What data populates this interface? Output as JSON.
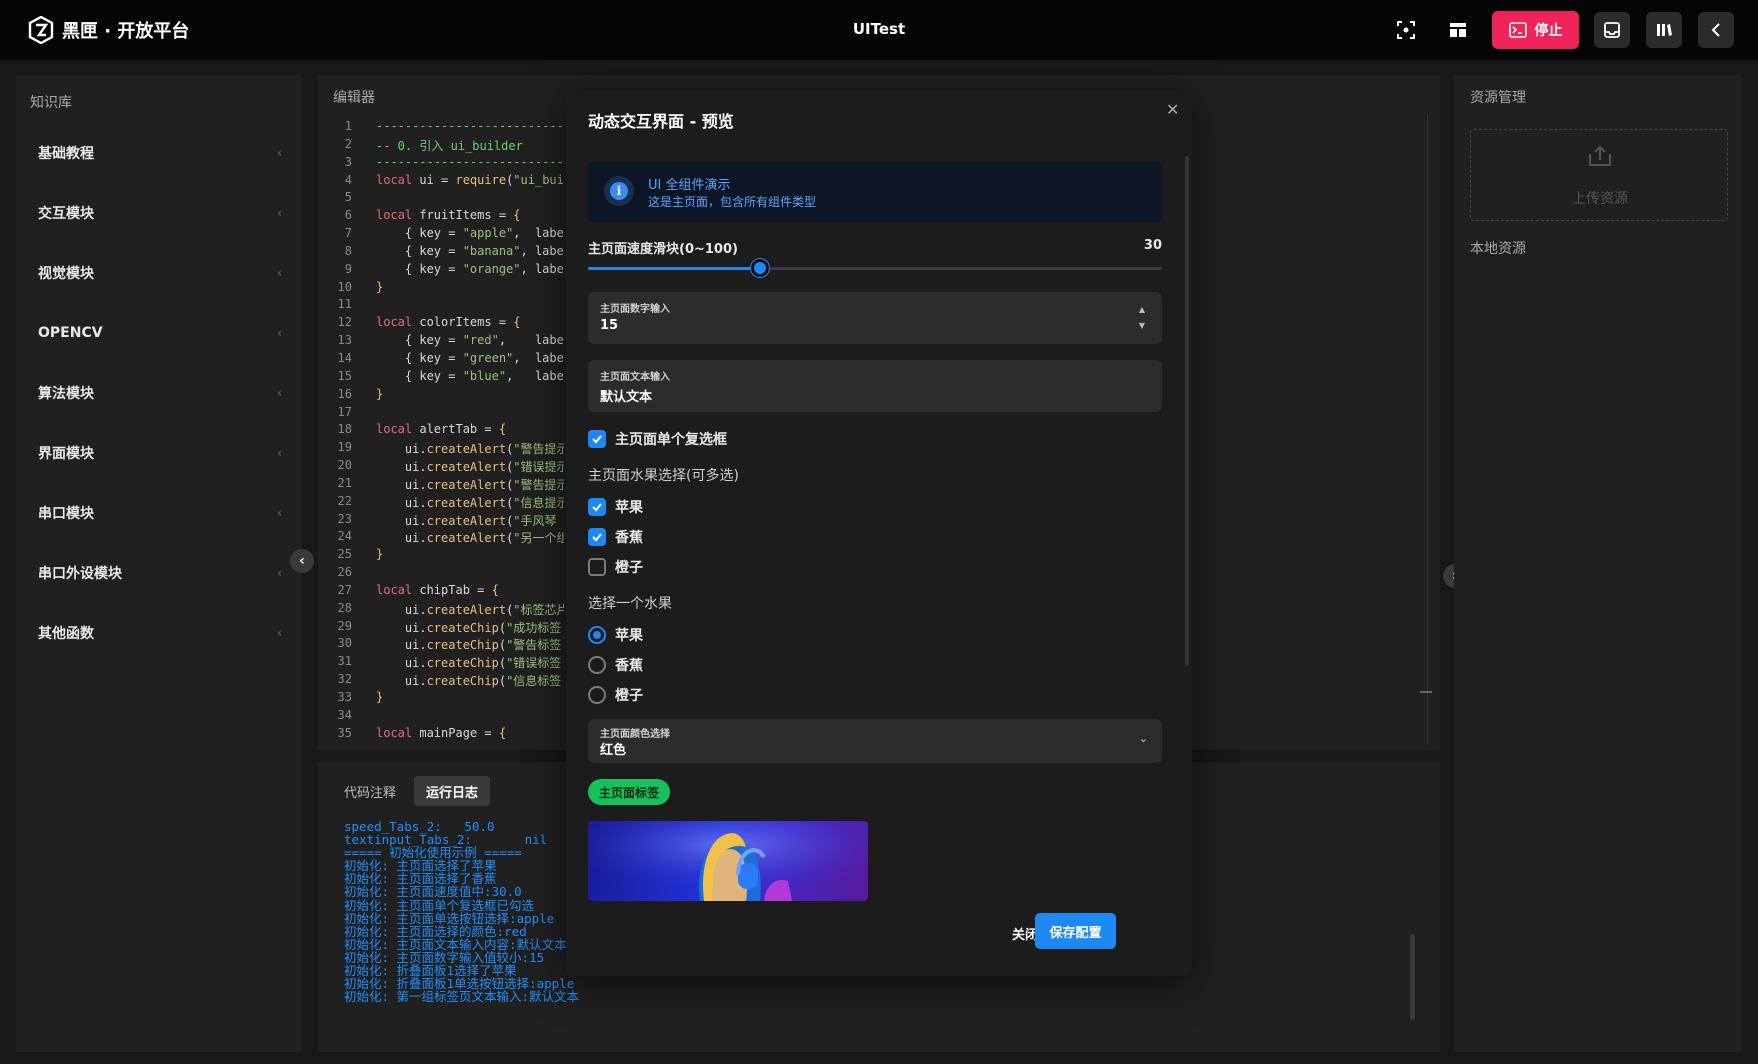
{
  "topbar": {
    "brand": "黑匣 · 开放平台",
    "title": "UITest",
    "stop_label": "停止"
  },
  "knowledge": {
    "title": "知识库",
    "items": [
      {
        "label": "基础教程"
      },
      {
        "label": "交互模块"
      },
      {
        "label": "视觉模块"
      },
      {
        "label": "OPENCV"
      },
      {
        "label": "算法模块"
      },
      {
        "label": "界面模块"
      },
      {
        "label": "串口模块"
      },
      {
        "label": "串口外设模块"
      },
      {
        "label": "其他函数"
      }
    ]
  },
  "editor": {
    "title": "编辑器",
    "lines": [
      [
        [
          "c-com",
          "------------------------------------------"
        ]
      ],
      [
        [
          "c-com",
          "-- 0. 引入 ui_builder"
        ]
      ],
      [
        [
          "c-com",
          "------------------------------------------"
        ]
      ],
      [
        [
          "c-kw",
          "local "
        ],
        [
          "c-id",
          "ui = "
        ],
        [
          "c-fn",
          "require"
        ],
        [
          "c-id",
          "("
        ],
        [
          "c-str",
          "\"ui_builder\""
        ]
      ],
      [],
      [
        [
          "c-kw",
          "local "
        ],
        [
          "c-id",
          "fruitItems = "
        ],
        [
          "c-br",
          "{"
        ]
      ],
      [
        [
          "c-id",
          "    { key = "
        ],
        [
          "c-str",
          "\"apple\""
        ],
        [
          "c-id",
          ",  label"
        ]
      ],
      [
        [
          "c-id",
          "    { key = "
        ],
        [
          "c-str",
          "\"banana\""
        ],
        [
          "c-id",
          ", label"
        ]
      ],
      [
        [
          "c-id",
          "    { key = "
        ],
        [
          "c-str",
          "\"orange\""
        ],
        [
          "c-id",
          ", label"
        ]
      ],
      [
        [
          "c-br",
          "}"
        ]
      ],
      [],
      [
        [
          "c-kw",
          "local "
        ],
        [
          "c-id",
          "colorItems = "
        ],
        [
          "c-br",
          "{"
        ]
      ],
      [
        [
          "c-id",
          "    { key = "
        ],
        [
          "c-str",
          "\"red\""
        ],
        [
          "c-id",
          ",    label"
        ]
      ],
      [
        [
          "c-id",
          "    { key = "
        ],
        [
          "c-str",
          "\"green\""
        ],
        [
          "c-id",
          ",  label"
        ]
      ],
      [
        [
          "c-id",
          "    { key = "
        ],
        [
          "c-str",
          "\"blue\""
        ],
        [
          "c-id",
          ",   label"
        ]
      ],
      [
        [
          "c-br",
          "}"
        ]
      ],
      [],
      [
        [
          "c-kw",
          "local "
        ],
        [
          "c-id",
          "alertTab = "
        ],
        [
          "c-br",
          "{"
        ]
      ],
      [
        [
          "c-id",
          "    ui."
        ],
        [
          "c-fn",
          "createAlert"
        ],
        [
          "c-id",
          "("
        ],
        [
          "c-str",
          "\"警告提示"
        ]
      ],
      [
        [
          "c-id",
          "    ui."
        ],
        [
          "c-fn",
          "createAlert"
        ],
        [
          "c-id",
          "("
        ],
        [
          "c-str",
          "\"错误提示"
        ]
      ],
      [
        [
          "c-id",
          "    ui."
        ],
        [
          "c-fn",
          "createAlert"
        ],
        [
          "c-id",
          "("
        ],
        [
          "c-str",
          "\"警告提示"
        ]
      ],
      [
        [
          "c-id",
          "    ui."
        ],
        [
          "c-fn",
          "createAlert"
        ],
        [
          "c-id",
          "("
        ],
        [
          "c-str",
          "\"信息提示"
        ]
      ],
      [
        [
          "c-id",
          "    ui."
        ],
        [
          "c-fn",
          "createAlert"
        ],
        [
          "c-id",
          "("
        ],
        [
          "c-str",
          "\"手风琴"
        ]
      ],
      [
        [
          "c-id",
          "    ui."
        ],
        [
          "c-fn",
          "createAlert"
        ],
        [
          "c-id",
          "("
        ],
        [
          "c-str",
          "\"另一个组"
        ]
      ],
      [
        [
          "c-br",
          "}"
        ]
      ],
      [],
      [
        [
          "c-kw",
          "local "
        ],
        [
          "c-id",
          "chipTab = "
        ],
        [
          "c-br",
          "{"
        ]
      ],
      [
        [
          "c-id",
          "    ui."
        ],
        [
          "c-fn",
          "createAlert"
        ],
        [
          "c-id",
          "("
        ],
        [
          "c-str",
          "\"标签芯片"
        ]
      ],
      [
        [
          "c-id",
          "    ui."
        ],
        [
          "c-fn",
          "createChip"
        ],
        [
          "c-id",
          "("
        ],
        [
          "c-str",
          "\"成功标签"
        ]
      ],
      [
        [
          "c-id",
          "    ui."
        ],
        [
          "c-fn",
          "createChip"
        ],
        [
          "c-id",
          "("
        ],
        [
          "c-str",
          "\"警告标签"
        ]
      ],
      [
        [
          "c-id",
          "    ui."
        ],
        [
          "c-fn",
          "createChip"
        ],
        [
          "c-id",
          "("
        ],
        [
          "c-str",
          "\"错误标签"
        ]
      ],
      [
        [
          "c-id",
          "    ui."
        ],
        [
          "c-fn",
          "createChip"
        ],
        [
          "c-id",
          "("
        ],
        [
          "c-str",
          "\"信息标签"
        ]
      ],
      [
        [
          "c-br",
          "}"
        ]
      ],
      [],
      [
        [
          "c-kw",
          "local "
        ],
        [
          "c-id",
          "mainPage = "
        ],
        [
          "c-br",
          "{"
        ]
      ]
    ]
  },
  "log": {
    "tabs": [
      {
        "label": "代码注释"
      },
      {
        "label": "运行日志"
      }
    ],
    "lines": [
      "speed_Tabs_2:   50.0",
      "textinput_Tabs_2:       nil",
      "===== 初始化使用示例 =====",
      "初始化: 主页面选择了苹果",
      "初始化: 主页面选择了香蕉",
      "初始化: 主页面速度值中:30.0",
      "初始化: 主页面单个复选框已勾选",
      "初始化: 主页面单选按钮选择:apple",
      "初始化: 主页面选择的颜色:red",
      "初始化: 主页面文本输入内容:默认文本",
      "初始化: 主页面数字输入值较小:15",
      "初始化: 折叠面板1选择了苹果",
      "初始化: 折叠面板1单选按钮选择:apple",
      "初始化: 第一组标签页文本输入:默认文本"
    ]
  },
  "resources": {
    "title": "资源管理",
    "upload_label": "上传资源",
    "local_label": "本地资源"
  },
  "modal": {
    "title": "动态交互界面 - 预览",
    "info": {
      "title": "UI 全组件演示",
      "text": "这是主页面，包含所有组件类型"
    },
    "slider": {
      "label": "主页面速度滑块(0~100)",
      "value": "30",
      "fraction": 0.3
    },
    "number_input": {
      "label": "主页面数字输入",
      "value": "15"
    },
    "text_input": {
      "label": "主页面文本输入",
      "value": "默认文本"
    },
    "single_checkbox": {
      "label": "主页面单个复选框",
      "checked": true
    },
    "multi_select": {
      "label": "主页面水果选择(可多选)",
      "options": [
        {
          "label": "苹果",
          "checked": true
        },
        {
          "label": "香蕉",
          "checked": true
        },
        {
          "label": "橙子",
          "checked": false
        }
      ]
    },
    "radio": {
      "label": "选择一个水果",
      "options": [
        {
          "label": "苹果",
          "checked": true
        },
        {
          "label": "香蕉",
          "checked": false
        },
        {
          "label": "橙子",
          "checked": false
        }
      ]
    },
    "color_select": {
      "label": "主页面颜色选择",
      "value": "红色"
    },
    "chip": "主页面标签",
    "close_label": "关闭",
    "save_label": "保存配置"
  },
  "colors": {
    "accent": "#1e88f5",
    "stop": "#f0245a",
    "chip": "#17c05a"
  }
}
